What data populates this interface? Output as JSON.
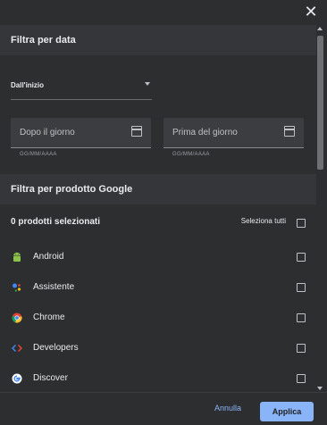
{
  "dialog": {
    "close_icon": "close-icon"
  },
  "date_filter": {
    "header": "Filtra per data",
    "select_value": "Dall'inizio",
    "after": {
      "label": "Dopo il giorno",
      "hint": "GG/MM/AAAA"
    },
    "before": {
      "label": "Prima del giorno",
      "hint": "GG/MM/AAAA"
    }
  },
  "product_filter": {
    "header": "Filtra per prodotto Google",
    "count_text": "0 prodotti selezionati",
    "select_all": "Seleziona tutti",
    "items": [
      {
        "label": "Android",
        "icon": "android-icon"
      },
      {
        "label": "Assistente",
        "icon": "assistant-icon"
      },
      {
        "label": "Chrome",
        "icon": "chrome-icon"
      },
      {
        "label": "Developers",
        "icon": "developers-icon"
      },
      {
        "label": "Discover",
        "icon": "discover-icon"
      }
    ]
  },
  "footer": {
    "cancel": "Annulla",
    "apply": "Applica"
  },
  "colors": {
    "background": "#2d2e30",
    "section_header": "#35363a",
    "accent": "#8ab4f8"
  }
}
